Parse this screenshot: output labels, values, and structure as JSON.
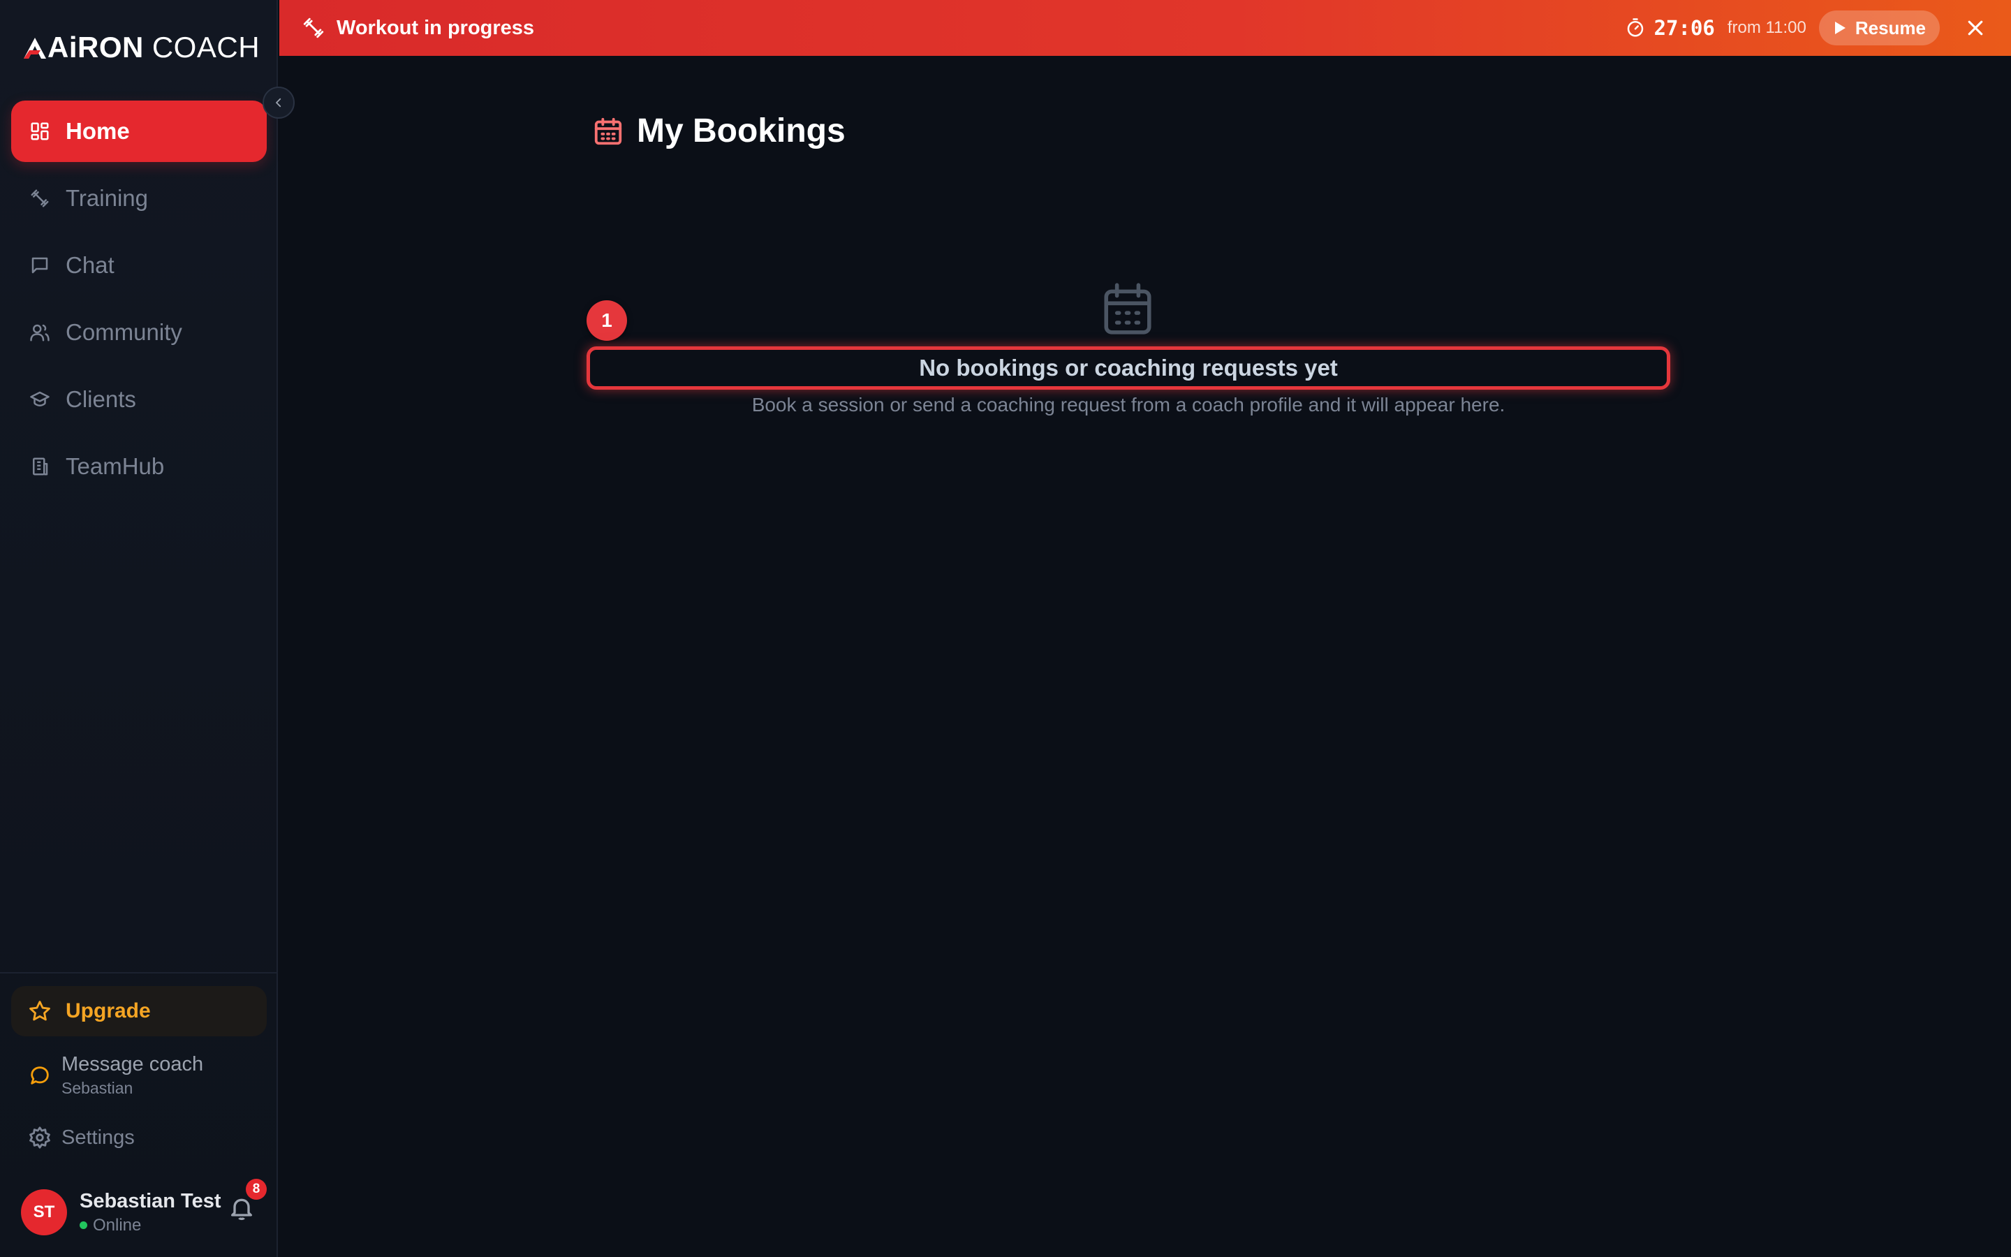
{
  "app": {
    "logo_primary": "AiRON",
    "logo_secondary": "COACH"
  },
  "sidebar": {
    "items": [
      {
        "label": "Home",
        "icon": "dashboard-icon",
        "active": true
      },
      {
        "label": "Training",
        "icon": "dumbbell-icon",
        "active": false
      },
      {
        "label": "Chat",
        "icon": "chat-icon",
        "active": false
      },
      {
        "label": "Community",
        "icon": "users-icon",
        "active": false
      },
      {
        "label": "Clients",
        "icon": "graduation-cap-icon",
        "active": false
      },
      {
        "label": "TeamHub",
        "icon": "building-icon",
        "active": false
      }
    ],
    "upgrade_label": "Upgrade",
    "message_coach": {
      "label": "Message coach",
      "coach_name": "Sebastian"
    },
    "settings_label": "Settings",
    "user": {
      "initials": "ST",
      "name": "Sebastian Test",
      "status": "Online",
      "notification_count": "8"
    }
  },
  "banner": {
    "title": "Workout in progress",
    "timer": "27:06",
    "from_text": "from 11:00",
    "resume_label": "Resume"
  },
  "main": {
    "title": "My Bookings",
    "empty_title": "No bookings or coaching requests yet",
    "empty_subtitle": "Book a session or send a coaching request from a coach profile and it will appear here.",
    "step_badge": "1"
  },
  "colors": {
    "accent": "#e5282e",
    "banner_start": "#d92a2a",
    "banner_end": "#ea5a1a",
    "upgrade": "#f5a524",
    "online": "#22c55e",
    "background": "#0b0f17"
  }
}
